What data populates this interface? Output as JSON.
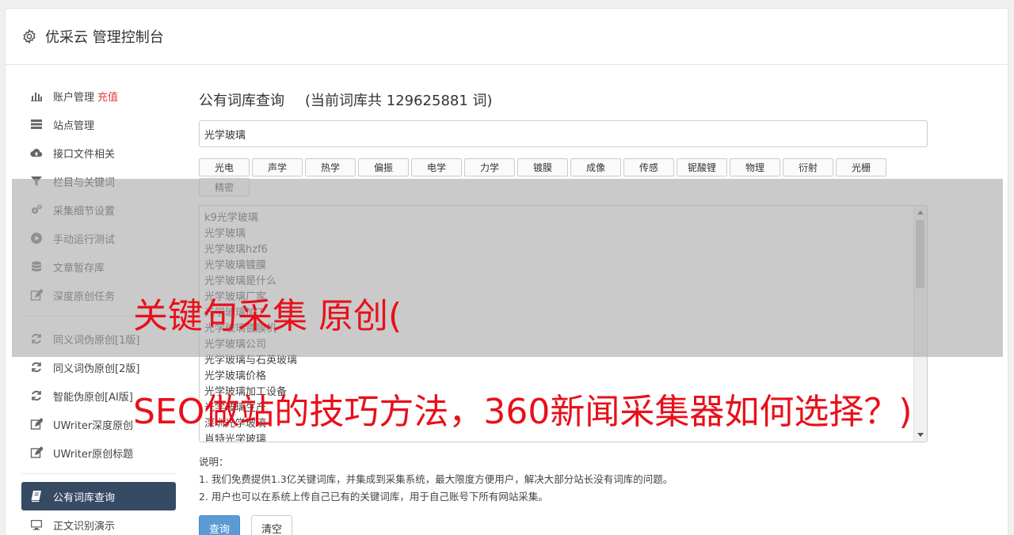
{
  "header": {
    "title": "优采云 管理控制台"
  },
  "sidebar": {
    "group1": [
      {
        "label": "账户管理",
        "badge": "充值",
        "icon": "bar-chart-icon"
      },
      {
        "label": "站点管理",
        "icon": "server-icon"
      },
      {
        "label": "接口文件相关",
        "icon": "cloud-upload-icon"
      },
      {
        "label": "栏目与关键词",
        "icon": "filter-icon"
      },
      {
        "label": "采集细节设置",
        "icon": "gears-icon"
      },
      {
        "label": "手动运行测试",
        "icon": "play-icon"
      },
      {
        "label": "文章暂存库",
        "icon": "database-icon"
      },
      {
        "label": "深度原创任务",
        "icon": "edit-icon"
      }
    ],
    "group2": [
      {
        "label": "同义词伪原创[1版]",
        "icon": "refresh-icon"
      },
      {
        "label": "同义词伪原创[2版]",
        "icon": "refresh-icon"
      },
      {
        "label": "智能伪原创[AI版]",
        "icon": "refresh-icon"
      },
      {
        "label": "UWriter深度原创",
        "icon": "edit-icon"
      },
      {
        "label": "UWriter原创标题",
        "icon": "edit-icon"
      }
    ],
    "group3": [
      {
        "label": "公有词库查询",
        "icon": "book-icon",
        "active": true
      },
      {
        "label": "正文识别演示",
        "icon": "monitor-icon"
      }
    ]
  },
  "main": {
    "title": "公有词库查询",
    "count_text": "(当前词库共 129625881 词)",
    "search_value": "光学玻璃",
    "tags": [
      "光电",
      "声学",
      "热学",
      "偏振",
      "电学",
      "力学",
      "镀膜",
      "成像",
      "传感",
      "铌酸锂",
      "物理",
      "衍射",
      "光栅",
      "精密"
    ],
    "results": [
      "k9光学玻璃",
      "光学玻璃",
      "光学玻璃hzf6",
      "光学玻璃镀膜",
      "光学玻璃是什么",
      "光学玻璃厂家",
      "光学玻璃加工",
      "光学玻璃镀膜机",
      "光学玻璃公司",
      "光学玻璃与石英玻璃",
      "光学玻璃价格",
      "光学玻璃加工设备",
      "光学玻璃生产",
      "深圳光学玻璃",
      "肖特光学玻璃"
    ],
    "notes_title": "说明：",
    "notes": [
      "1. 我们免费提供1.3亿关键词库，并集成到采集系统，最大限度方便用户，解决大部分站长没有词库的问题。",
      "2. 用户也可以在系统上传自己已有的关键词库，用于自己账号下所有网站采集。"
    ],
    "query_button": "查询",
    "clear_button": "清空"
  },
  "overlay": {
    "line1": "关键句采集 原创(",
    "line2": "SEO做站的技巧方法，360新闻采集器如何选择？)"
  },
  "colors": {
    "active_nav": "#364a63",
    "primary_button": "#5b9bd5",
    "badge": "#e4393c",
    "overlay_text": "#e8101a"
  }
}
